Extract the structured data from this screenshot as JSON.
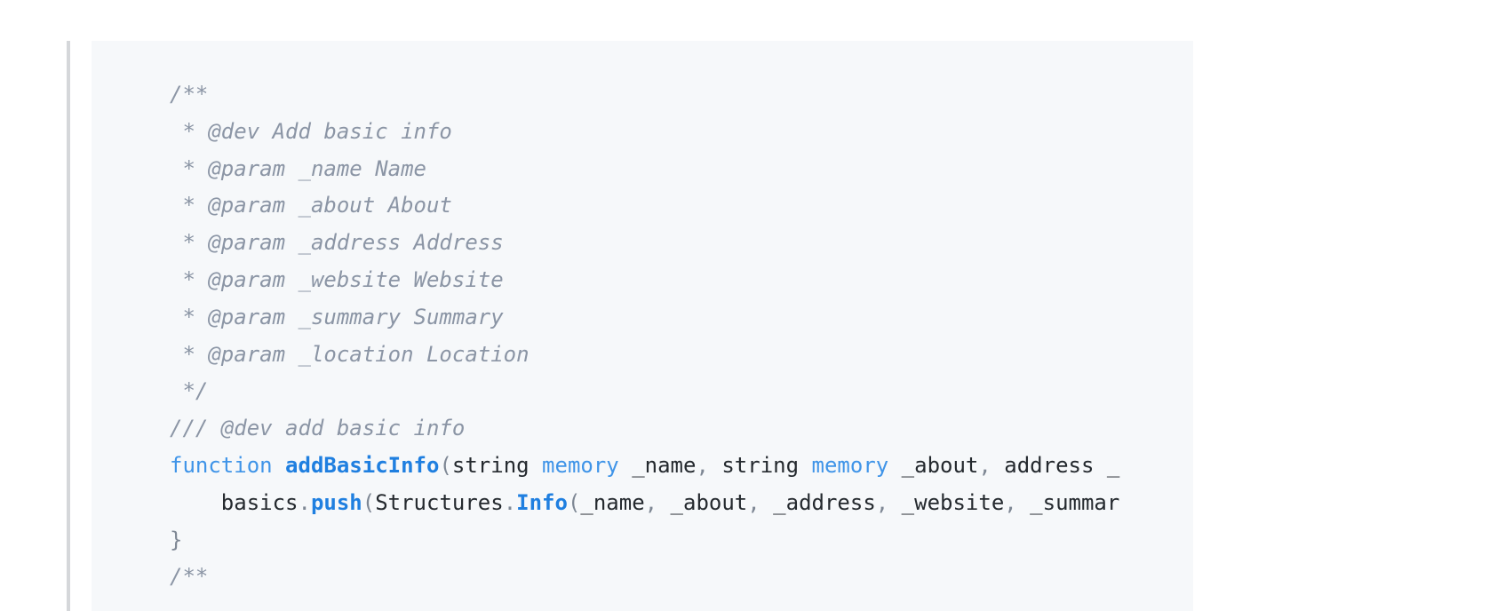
{
  "page": {
    "background_color": "#ffffff",
    "kind": "source-code-listing"
  },
  "left_rule": {
    "color": "#d5d7da",
    "label": "blockquote-left-rule"
  },
  "code_block": {
    "background_color": "#f6f8fa",
    "language": "solidity",
    "font_size_px": 24,
    "line_height_px": 42,
    "clipped_right": true,
    "clipped_bottom": true,
    "colors": {
      "comment": "#8b95a5",
      "keyword": "#3f94e8",
      "function_name": "#1f7fe0",
      "method_name": "#1f7fe0",
      "plain_text": "#24292e",
      "punctuation": "#7e8794"
    },
    "lines": [
      {
        "id": "line-1",
        "indent": "",
        "tokens": [
          {
            "t": "/**",
            "c": "comment"
          }
        ]
      },
      {
        "id": "line-2",
        "indent": "",
        "tokens": [
          {
            "t": " * @dev Add basic info",
            "c": "comment"
          }
        ]
      },
      {
        "id": "line-3",
        "indent": "",
        "tokens": [
          {
            "t": " * @param _name Name",
            "c": "comment"
          }
        ]
      },
      {
        "id": "line-4",
        "indent": "",
        "tokens": [
          {
            "t": " * @param _about About",
            "c": "comment"
          }
        ]
      },
      {
        "id": "line-5",
        "indent": "",
        "tokens": [
          {
            "t": " * @param _address Address",
            "c": "comment"
          }
        ]
      },
      {
        "id": "line-6",
        "indent": "",
        "tokens": [
          {
            "t": " * @param _website Website",
            "c": "comment"
          }
        ]
      },
      {
        "id": "line-7",
        "indent": "",
        "tokens": [
          {
            "t": " * @param _summary Summary",
            "c": "comment"
          }
        ]
      },
      {
        "id": "line-8",
        "indent": "",
        "tokens": [
          {
            "t": " * @param _location Location",
            "c": "comment"
          }
        ]
      },
      {
        "id": "line-9",
        "indent": "",
        "tokens": [
          {
            "t": " */",
            "c": "comment"
          }
        ]
      },
      {
        "id": "line-10",
        "indent": "",
        "tokens": [
          {
            "t": "/// @dev add basic info",
            "c": "comment"
          }
        ]
      },
      {
        "id": "line-11",
        "indent": "",
        "tokens": [
          {
            "t": "function",
            "c": "keyword"
          },
          {
            "t": " ",
            "c": "plain"
          },
          {
            "t": "addBasicInfo",
            "c": "function"
          },
          {
            "t": "(",
            "c": "punct"
          },
          {
            "t": "string",
            "c": "plain"
          },
          {
            "t": " ",
            "c": "plain"
          },
          {
            "t": "memory",
            "c": "keyword"
          },
          {
            "t": " _name",
            "c": "plain"
          },
          {
            "t": ",",
            "c": "punct"
          },
          {
            "t": " string",
            "c": "plain"
          },
          {
            "t": " ",
            "c": "plain"
          },
          {
            "t": "memory",
            "c": "keyword"
          },
          {
            "t": " _about",
            "c": "plain"
          },
          {
            "t": ",",
            "c": "punct"
          },
          {
            "t": " address _",
            "c": "plain"
          }
        ]
      },
      {
        "id": "line-12",
        "indent": "    ",
        "tokens": [
          {
            "t": "    basics",
            "c": "plain"
          },
          {
            "t": ".",
            "c": "punct"
          },
          {
            "t": "push",
            "c": "method"
          },
          {
            "t": "(",
            "c": "punct"
          },
          {
            "t": "Structures",
            "c": "plain"
          },
          {
            "t": ".",
            "c": "punct"
          },
          {
            "t": "Info",
            "c": "method"
          },
          {
            "t": "(",
            "c": "punct"
          },
          {
            "t": "_name",
            "c": "plain"
          },
          {
            "t": ",",
            "c": "punct"
          },
          {
            "t": " _about",
            "c": "plain"
          },
          {
            "t": ",",
            "c": "punct"
          },
          {
            "t": " _address",
            "c": "plain"
          },
          {
            "t": ",",
            "c": "punct"
          },
          {
            "t": " _website",
            "c": "plain"
          },
          {
            "t": ",",
            "c": "punct"
          },
          {
            "t": " _summar",
            "c": "plain"
          }
        ]
      },
      {
        "id": "line-13",
        "indent": "",
        "tokens": [
          {
            "t": "}",
            "c": "punct"
          }
        ]
      },
      {
        "id": "line-14",
        "indent": "",
        "tokens": [
          {
            "t": "/**",
            "c": "comment"
          }
        ]
      }
    ]
  }
}
